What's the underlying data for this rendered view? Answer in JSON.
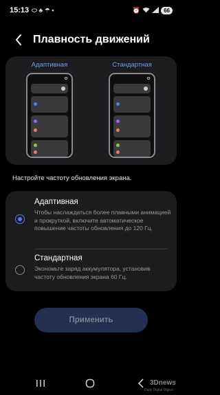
{
  "status_bar": {
    "time": "15:13",
    "battery": "66"
  },
  "header": {
    "title": "Плавность движений"
  },
  "preview": {
    "left_label": "Адаптивная",
    "right_label": "Стандартная"
  },
  "description": "Настройте частоту обновления экрана.",
  "options": [
    {
      "title": "Адаптивная",
      "subtitle": "Чтобы наслаждаться более плавными анимацией и прокруткой, включите автоматическое повышение частоты обновления до 120 Гц.",
      "selected": true
    },
    {
      "title": "Стандартная",
      "subtitle": "Экономьте заряд аккумулятора, установив частоту обновления экрана 60 Гц.",
      "selected": false
    }
  ],
  "apply_button": {
    "label": "Применить"
  },
  "watermark": {
    "logo": "3Dnews",
    "tagline": "Daily Digital Digest"
  },
  "colors": {
    "accent": "#4a7cf2",
    "label_blue": "#6f9cf5",
    "card_bg": "#1c1c1e",
    "button_bg": "#233150"
  }
}
